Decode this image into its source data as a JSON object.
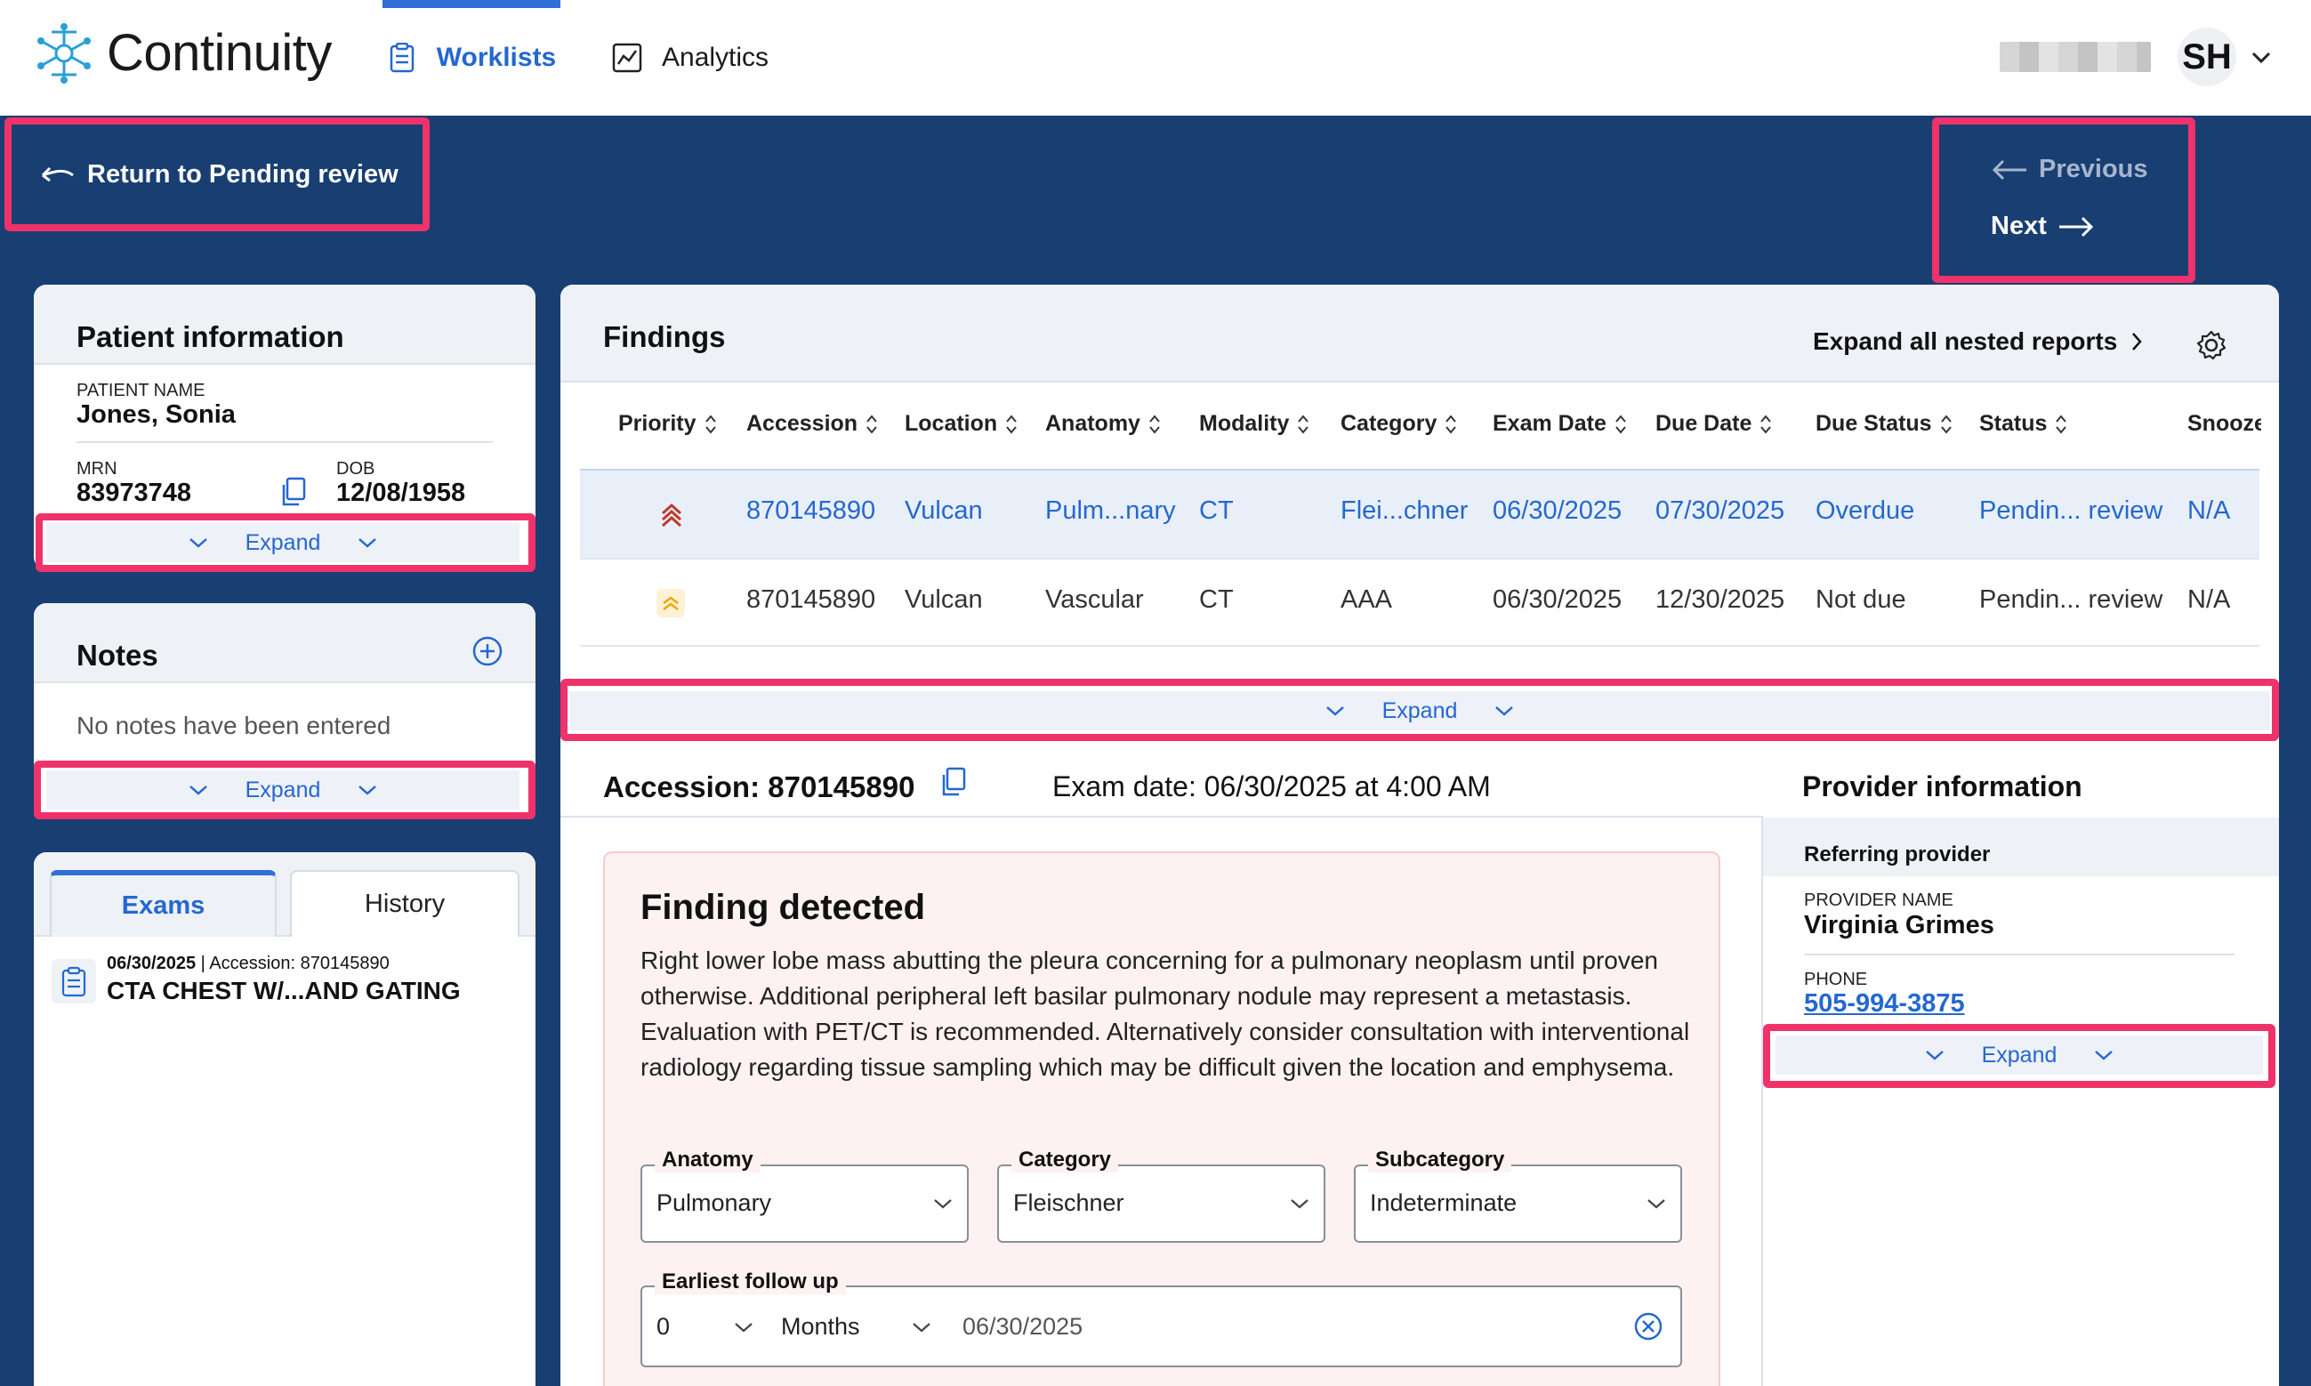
{
  "app": {
    "name": "Continuity",
    "nav": [
      {
        "label": "Worklists",
        "active": true
      },
      {
        "label": "Analytics",
        "active": false
      }
    ],
    "user_initials": "SH"
  },
  "actions": {
    "return_label": "Return to Pending review",
    "previous_label": "Previous",
    "next_label": "Next"
  },
  "patient": {
    "title": "Patient information",
    "name_label": "PATIENT NAME",
    "name": "Jones, Sonia",
    "mrn_label": "MRN",
    "mrn": "83973748",
    "dob_label": "DOB",
    "dob": "12/08/1958",
    "expand_label": "Expand"
  },
  "notes": {
    "title": "Notes",
    "empty_text": "No notes have been entered",
    "expand_label": "Expand"
  },
  "exams_panel": {
    "tabs": [
      "Exams",
      "History"
    ],
    "item_date": "06/30/2025",
    "item_separator": "|",
    "item_accession_label": "Accession:",
    "item_accession": "870145890",
    "item_title": "CTA CHEST W/...AND GATING"
  },
  "findings": {
    "title": "Findings",
    "expand_all_label": "Expand all nested reports",
    "columns": [
      "Priority",
      "Accession",
      "Location",
      "Anatomy",
      "Modality",
      "Category",
      "Exam Date",
      "Due Date",
      "Due Status",
      "Status",
      "Snooze"
    ],
    "rows": [
      {
        "priority": "high",
        "accession": "870145890",
        "location": "Vulcan",
        "anatomy": "Pulm...nary",
        "modality": "CT",
        "category": "Flei...chner",
        "exam_date": "06/30/2025",
        "due_date": "07/30/2025",
        "due_status": "Overdue",
        "status": "Pendin... review",
        "snooze": "N/A"
      },
      {
        "priority": "medium",
        "accession": "870145890",
        "location": "Vulcan",
        "anatomy": "Vascular",
        "modality": "CT",
        "category": "AAA",
        "exam_date": "06/30/2025",
        "due_date": "12/30/2025",
        "due_status": "Not due",
        "status": "Pendin... review",
        "snooze": "N/A"
      }
    ],
    "expand_label": "Expand",
    "colors": {
      "high": "#c0392b",
      "medium": "#f0a500",
      "link": "#2468d0"
    }
  },
  "detail": {
    "accession_label": "Accession: 870145890",
    "exam_date_label": "Exam date: 06/30/2025 at 4:00 AM",
    "finding_title": "Finding detected",
    "finding_text": "Right lower lobe mass abutting the pleura concerning for a pulmonary neoplasm until proven otherwise. Additional peripheral left basilar pulmonary nodule may represent a metastasis. Evaluation with PET/CT is recommended. Alternatively consider consultation with interventional radiology regarding tissue sampling which may be difficult given the location and emphysema.",
    "anatomy_label": "Anatomy",
    "anatomy_value": "Pulmonary",
    "category_label": "Category",
    "category_value": "Fleischner",
    "subcategory_label": "Subcategory",
    "subcategory_value": "Indeterminate",
    "followup_label": "Earliest follow up",
    "followup_number": "0",
    "followup_unit": "Months",
    "followup_date": "06/30/2025"
  },
  "provider": {
    "title": "Provider information",
    "section": "Referring provider",
    "name_label": "PROVIDER NAME",
    "name": "Virginia Grimes",
    "phone_label": "PHONE",
    "phone": "505-994-3875",
    "expand_label": "Expand"
  }
}
